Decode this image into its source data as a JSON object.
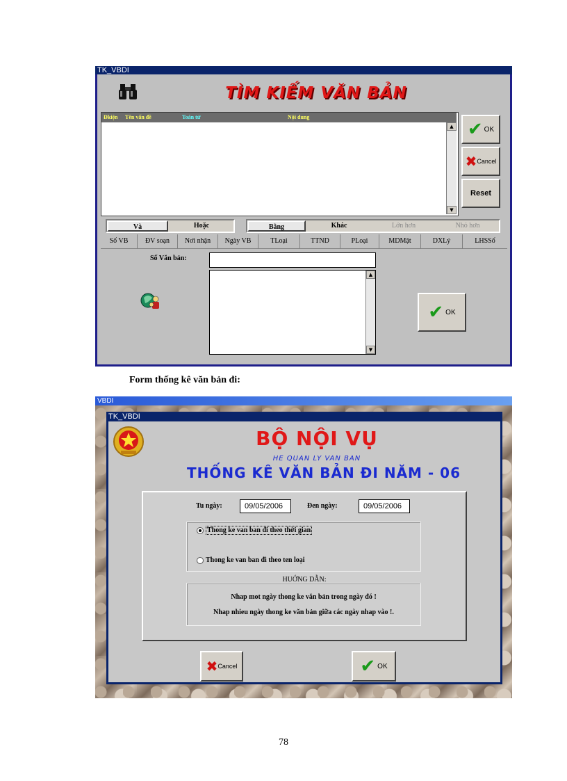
{
  "form1": {
    "window_title": "TK_VBDI",
    "banner": "TÌM KIẾM VĂN BẢN",
    "grid_headers": [
      "Đkiện",
      "Tên vấn đề",
      "Toán tử",
      "Nội dung"
    ],
    "ok_label": "OK",
    "cancel_label": "Cancel",
    "reset_label": "Reset",
    "logic_ops": [
      "Và",
      "Hoặc"
    ],
    "compare_ops": [
      "Bằng",
      "Khác",
      "Lớn hơn",
      "Nhỏ hơn"
    ],
    "tabs": [
      "Số VB",
      "ĐV soạn",
      "Nơi nhận",
      "Ngày VB",
      "TLoại",
      "TTND",
      "PLoại",
      "MDMật",
      "DXLý",
      "LHSSố"
    ],
    "field_label": "Số Văn bản:",
    "field_value": "",
    "ok2_label": "OK"
  },
  "caption": "Form thống kê văn bản đi:",
  "form2": {
    "outer_title": "VBDI",
    "window_title": "TK_VBDI",
    "ministry": "BỘ NỘI VỤ",
    "system": "HE QUAN LY VAN BAN",
    "heading": "THỐNG KÊ VĂN BẢN ĐI NĂM - 06",
    "from_label": "Tu ngày:",
    "from_value": "09/05/2006",
    "to_label": "Đen ngày:",
    "to_value": "09/05/2006",
    "radio1": "Thong ke van ban đi theo thời gian",
    "radio2": "Thong ke van ban đi theo ten loại",
    "guide_title": "HUỚNG DẪN:",
    "guide_line1": "Nhap mot ngày thong ke văn bản trong ngày đó !",
    "guide_line2": "Nhap nhieu ngày thong ke văn bản giữa các ngày nhap vào !.",
    "cancel_label": "Cancel",
    "ok_label": "OK"
  },
  "page_number": "78",
  "colors": {
    "title_bar": "#0a246a",
    "banner_red": "#e01818",
    "heading_blue": "#1a2ad0",
    "check_green": "#1a9a1a"
  }
}
